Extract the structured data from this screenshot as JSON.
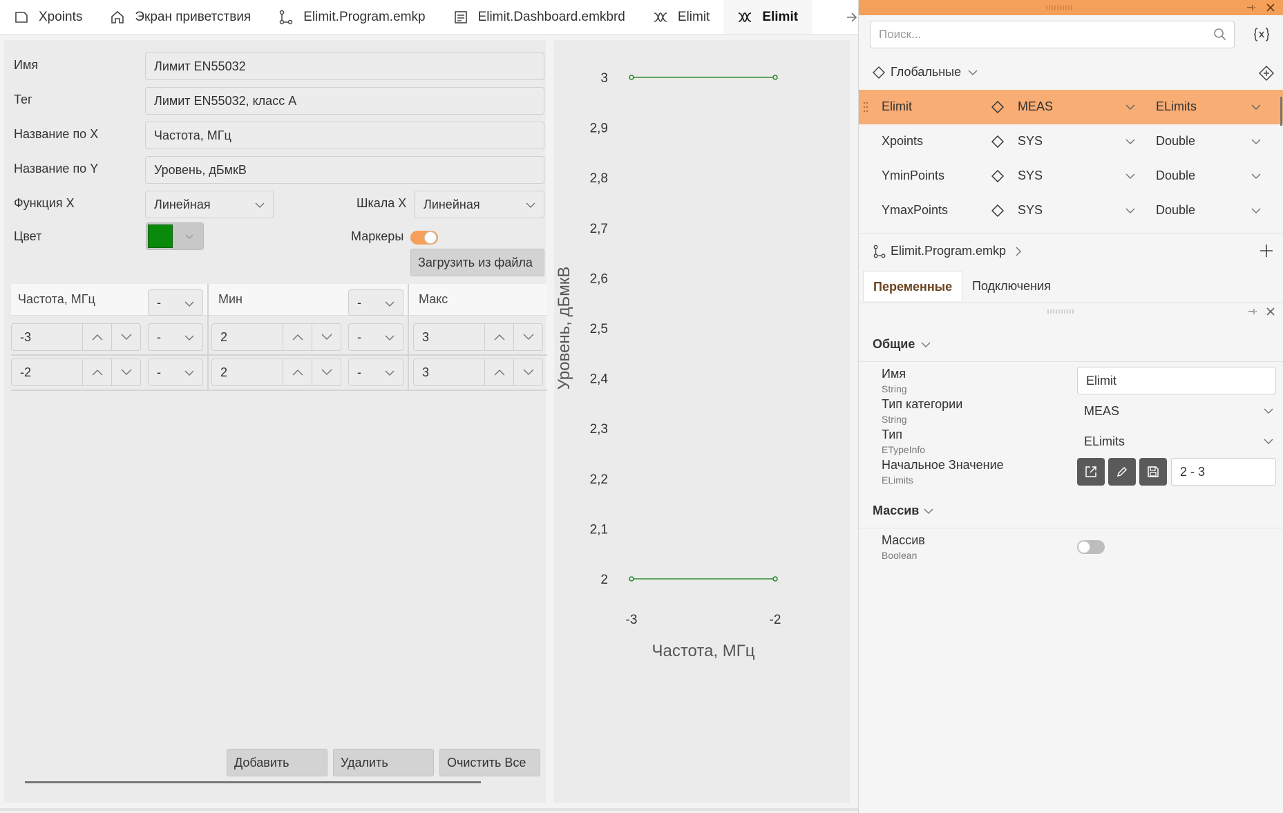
{
  "tabs": [
    {
      "label": "Xpoints",
      "icon": "page-icon"
    },
    {
      "label": "Экран приветствия",
      "icon": "home-icon"
    },
    {
      "label": "Elimit.Program.emkp",
      "icon": "program-icon"
    },
    {
      "label": "Elimit.Dashboard.emkbrd",
      "icon": "dashboard-icon"
    },
    {
      "label": "Elimit",
      "icon": "limit-icon"
    },
    {
      "label": "Elimit",
      "icon": "limit-icon",
      "active": true
    }
  ],
  "form": {
    "name_label": "Имя",
    "name_value": "Лимит EN55032",
    "tag_label": "Тег",
    "tag_value": "Лимит EN55032, класс A",
    "xtitle_label": "Название по X",
    "xtitle_value": "Частота, МГц",
    "ytitle_label": "Название по Y",
    "ytitle_value": "Уровень, дБмкВ",
    "func_x_label": "Функция X",
    "func_x_value": "Линейная",
    "scale_x_label": "Шкала X",
    "scale_x_value": "Линейная",
    "color_label": "Цвет",
    "color_value": "#0a8a0a",
    "markers_label": "Маркеры",
    "markers_on": true,
    "load_button": "Загрузить из файла"
  },
  "grid": {
    "headers": [
      {
        "label": "Частота, МГц",
        "unit": "-"
      },
      {
        "label": "Мин",
        "unit": "-"
      },
      {
        "label": "Макс"
      }
    ],
    "rows": [
      {
        "x": "-3",
        "x_unit": "-",
        "min": "2",
        "min_unit": "-",
        "max": "3"
      },
      {
        "x": "-2",
        "x_unit": "-",
        "min": "2",
        "min_unit": "-",
        "max": "3"
      }
    ],
    "add_button": "Добавить",
    "delete_button": "Удалить",
    "clear_button": "Очистить Все"
  },
  "chart_data": {
    "type": "line",
    "xlabel": "Частота, МГц",
    "ylabel": "Уровень, дБмкВ",
    "x": [
      -3,
      -2
    ],
    "series": [
      {
        "values": [
          3,
          3
        ],
        "color": "#2e8b2e"
      },
      {
        "values": [
          2,
          2
        ],
        "color": "#2e8b2e"
      }
    ],
    "xlim": [
      -3,
      -2
    ],
    "ylim": [
      2,
      3
    ],
    "x_ticks": [
      "-3",
      "-2"
    ],
    "y_ticks": [
      "3",
      "2,9",
      "2,8",
      "2,7",
      "2,6",
      "2,5",
      "2,4",
      "2,3",
      "2,2",
      "2,1",
      "2"
    ],
    "markers": true,
    "grid": false
  },
  "panel": {
    "search_placeholder": "Поиск...",
    "globals_label": "Глобальные",
    "variables": [
      {
        "name": "Elimit",
        "category": "MEAS",
        "type": "ELimits",
        "selected": true
      },
      {
        "name": "Xpoints",
        "category": "SYS",
        "type": "Double"
      },
      {
        "name": "YminPoints",
        "category": "SYS",
        "type": "Double"
      },
      {
        "name": "YmaxPoints",
        "category": "SYS",
        "type": "Double"
      }
    ],
    "program_label": "Elimit.Program.emkp",
    "tab_variables": "Переменные",
    "tab_connections": "Подключения",
    "section_general": "Общие",
    "props": {
      "name_label": "Имя",
      "name_type": "String",
      "name_value": "Elimit",
      "cat_label": "Тип категории",
      "cat_type": "String",
      "cat_value": "MEAS",
      "type_label": "Тип",
      "type_type": "ETypeInfo",
      "type_value": "ELimits",
      "init_label": "Начальное Значение",
      "init_type": "ELimits",
      "init_value": "2 - 3"
    },
    "section_array": "Массив",
    "array_label": "Массив",
    "array_type": "Boolean",
    "array_on": false,
    "accent": "#f5a05a"
  }
}
